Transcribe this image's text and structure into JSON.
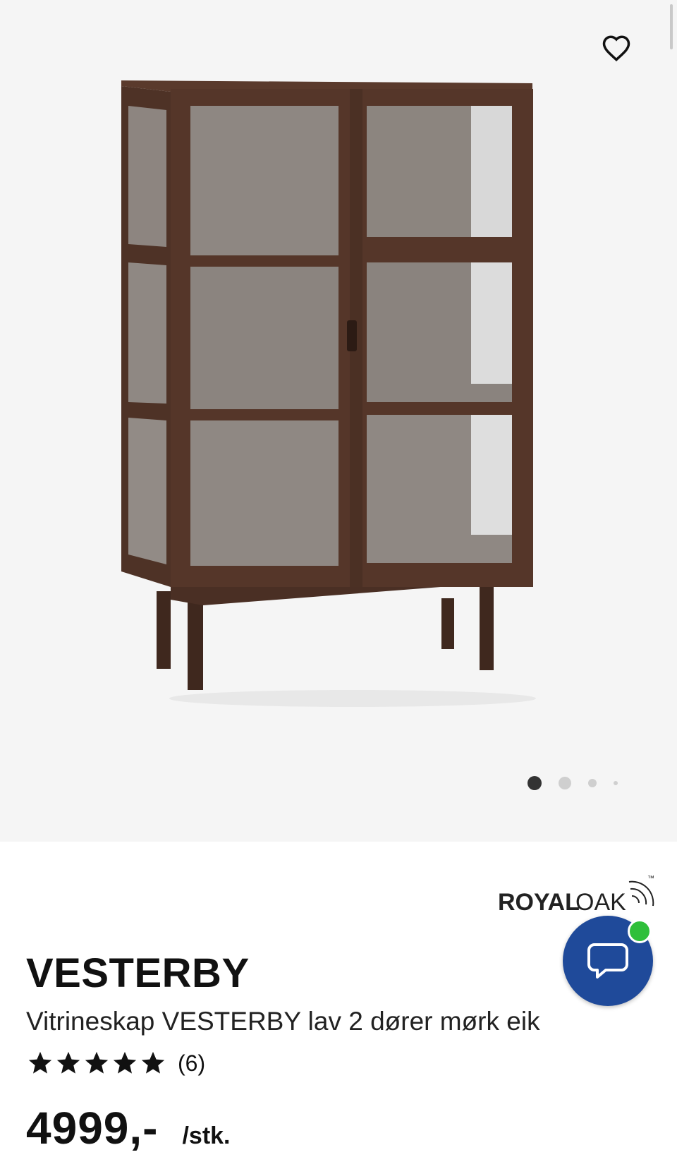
{
  "gallery": {
    "favorite_icon": "heart-outline-icon",
    "image_alt": "Vitrineskap VESTERBY lav 2 dører mørk eik",
    "carousel": {
      "total": 4,
      "active": 1
    }
  },
  "brand": {
    "logo_text_bold": "ROYAL",
    "logo_text_light": "OAK",
    "trademark": "™"
  },
  "chat": {
    "icon": "chat-bubble-icon",
    "status_color": "#2fbf3a",
    "button_color": "#1f4a9a"
  },
  "product": {
    "name": "VESTERBY",
    "description": "Vitrineskap VESTERBY lav 2 dører mørk eik",
    "rating": {
      "stars": 5,
      "count_label": "(6)"
    },
    "price": "4999,-",
    "unit": "/stk."
  }
}
